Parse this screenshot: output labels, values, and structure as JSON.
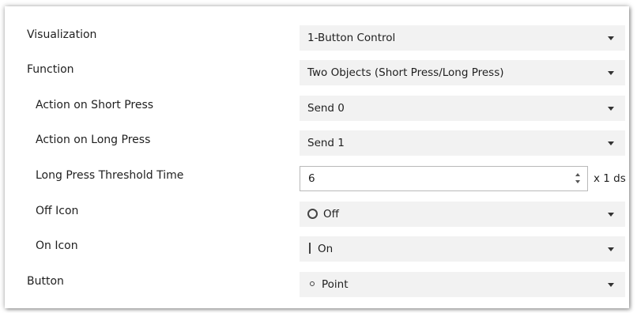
{
  "params": [
    {
      "label": "Visualization",
      "value": "1-Button Control"
    },
    {
      "label": "Function",
      "value": "Two Objects (Short Press/Long Press)"
    },
    {
      "label": "Action on Short Press",
      "value": "Send 0"
    },
    {
      "label": "Action on Long Press",
      "value": "Send 1"
    },
    {
      "label": "Long Press Threshold Time",
      "value": "6",
      "unit": "x 1 ds"
    },
    {
      "label": "Off Icon",
      "value": "Off",
      "icon": "ring-icon"
    },
    {
      "label": "On Icon",
      "value": "On",
      "icon": "bar-icon"
    },
    {
      "label": "Button",
      "value": "Point",
      "icon": "dot-icon"
    }
  ]
}
